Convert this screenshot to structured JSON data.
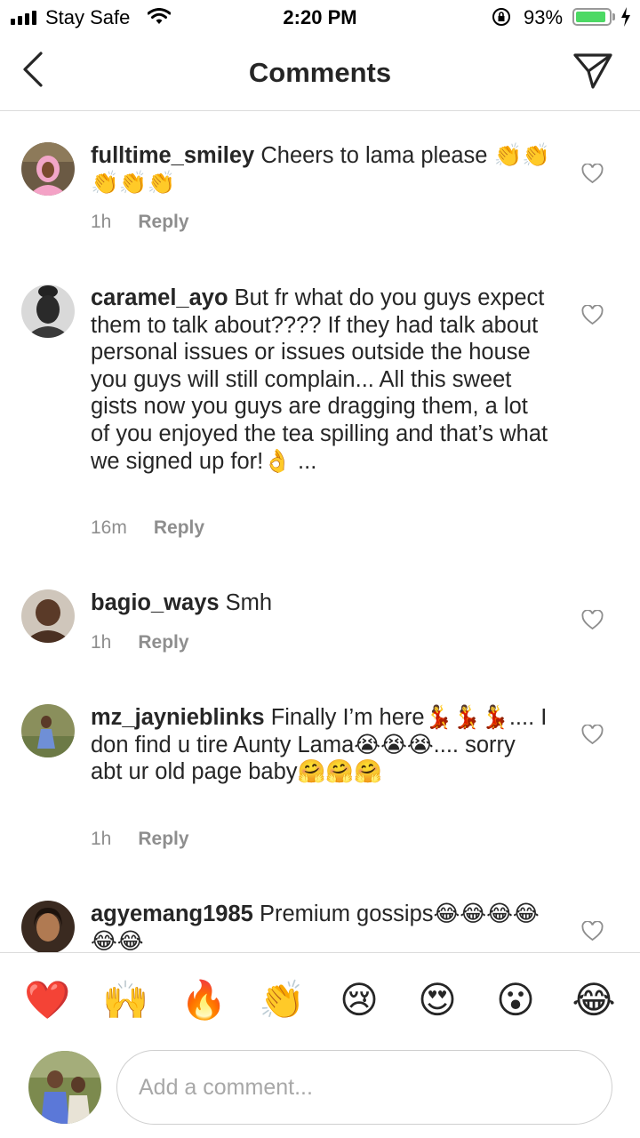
{
  "status_bar": {
    "carrier": "Stay Safe",
    "time": "2:20 PM",
    "battery_percent": "93%",
    "battery_level": 0.93,
    "battery_color": "#4cd964"
  },
  "header": {
    "title": "Comments",
    "back_icon": "chevron-left-icon",
    "send_icon": "paper-plane-icon"
  },
  "comments": [
    {
      "username": "fulltime_smiley",
      "text": "Cheers to lama please 👏👏👏👏👏",
      "time": "1h",
      "reply_label": "Reply"
    },
    {
      "username": "caramel_ayo",
      "text": "But fr what do you guys expect them to talk about???? If they had talk about personal issues or  issues outside the house you guys  will still complain... All this sweet gists now you guys are dragging them, a lot of you enjoyed the tea spilling and that’s what we signed up for!👌 ...",
      "time": "16m",
      "reply_label": "Reply"
    },
    {
      "username": "bagio_ways",
      "text": "Smh",
      "time": "1h",
      "reply_label": "Reply"
    },
    {
      "username": "mz_jaynieblinks",
      "text": "Finally I’m here💃💃💃.... I don find u tire Aunty Lama😭😭😭.... sorry abt ur old page baby🤗🤗🤗",
      "time": "1h",
      "reply_label": "Reply"
    },
    {
      "username": "agyemang1985",
      "text": "Premium gossips😂😂😂😂😂😂",
      "time": "",
      "reply_label": ""
    }
  ],
  "reactions": [
    "❤️",
    "🙌",
    "🔥",
    "👏",
    "😢",
    "😍",
    "😮",
    "😂"
  ],
  "composer": {
    "placeholder": "Add a comment..."
  }
}
